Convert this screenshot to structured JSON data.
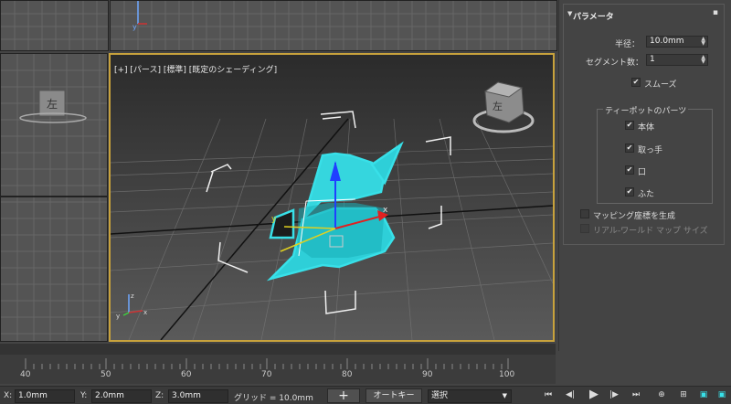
{
  "viewport": {
    "label": "[+] [パース] [標準] [既定のシェーディング]",
    "viewcube_face": "左",
    "viewcube_face_left": "左"
  },
  "panel": {
    "title": "パラメータ",
    "radius_label": "半径：",
    "radius_value": "10.0mm",
    "segments_label": "セグメント数：",
    "segments_value": "1",
    "smooth_label": "スムーズ",
    "parts_group": "ティーポットのパーツ",
    "parts": [
      "本体",
      "取っ手",
      "口",
      "ふた"
    ],
    "mapping_label": "マッピング座標を生成",
    "realworld_label": "リアル-ワールド マップ サイズ"
  },
  "timeline": {
    "ticks": [
      "40",
      "50",
      "60",
      "70",
      "80",
      "90",
      "100"
    ]
  },
  "status": {
    "x_label": "X:",
    "x_value": "1.0mm",
    "y_label": "Y:",
    "y_value": "2.0mm",
    "z_label": "Z:",
    "z_value": "3.0mm",
    "grid_label": "グリッド = 10.0mm",
    "autokey_label": "オートキー",
    "selection_value": "選択"
  },
  "colors": {
    "selection_cyan": "#38e0e8",
    "active_border": "#c8a23c"
  }
}
